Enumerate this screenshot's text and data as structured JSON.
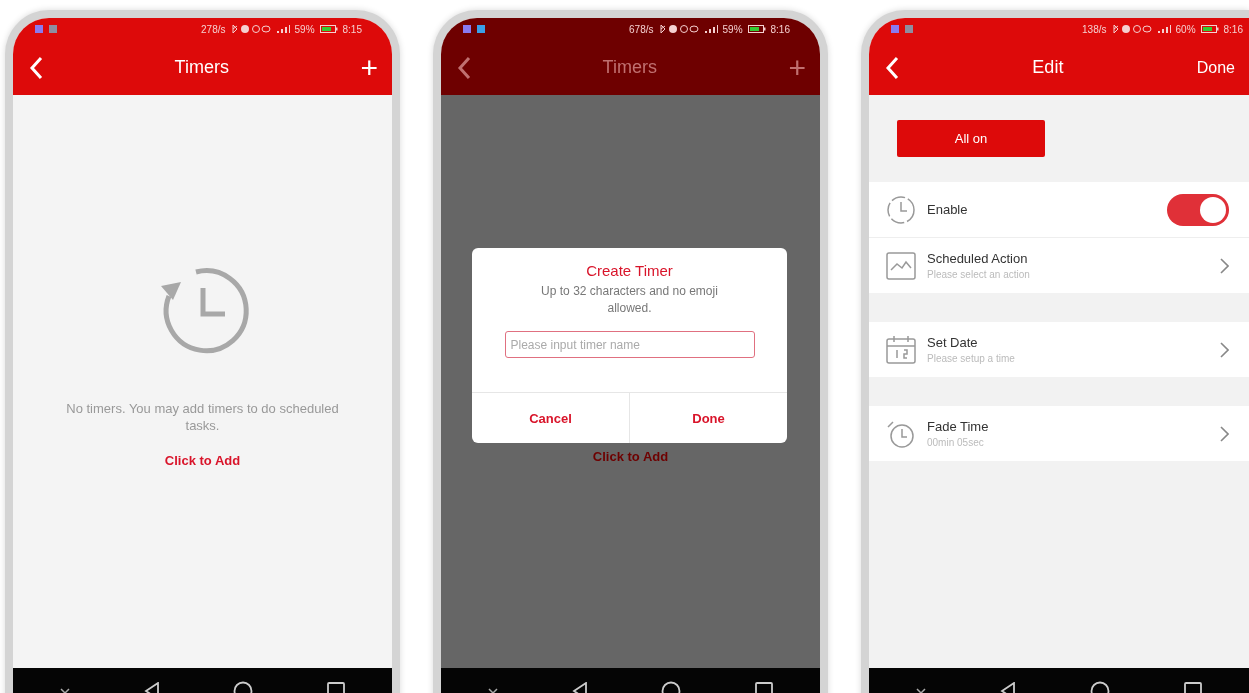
{
  "phones": [
    {
      "kind": "timers",
      "dimmed": false,
      "status": {
        "speed": "278/s",
        "battery": "59%",
        "time": "8:15"
      },
      "header": {
        "title": "Timers",
        "action": "+"
      },
      "empty_message": "No timers. You may add timers to do scheduled tasks.",
      "add_link": "Click to Add"
    },
    {
      "kind": "timers",
      "dimmed": true,
      "status": {
        "speed": "678/s",
        "battery": "59%",
        "time": "8:16"
      },
      "header": {
        "title": "Timers",
        "action": "+"
      },
      "add_link": "Click to Add",
      "dialog": {
        "title": "Create Timer",
        "message": "Up to 32 characters and no emoji allowed.",
        "placeholder": "Please input timer name",
        "buttons": [
          "Cancel",
          "Done"
        ]
      }
    },
    {
      "kind": "edit",
      "dimmed": false,
      "status": {
        "speed": "138/s",
        "battery": "60%",
        "time": "8:16"
      },
      "header": {
        "title": "Edit",
        "action": "Done"
      },
      "all_on_button": "All on",
      "groups": [
        [
          {
            "kind": "toggle",
            "label": "Enable",
            "on": true
          },
          {
            "kind": "link",
            "label": "Scheduled Action",
            "value": "Please select an action"
          }
        ],
        [
          {
            "kind": "link",
            "label": "Set Date",
            "value": "Please setup a time"
          }
        ],
        [
          {
            "kind": "link",
            "label": "Fade Time",
            "value": "00min  05sec"
          }
        ]
      ]
    }
  ]
}
